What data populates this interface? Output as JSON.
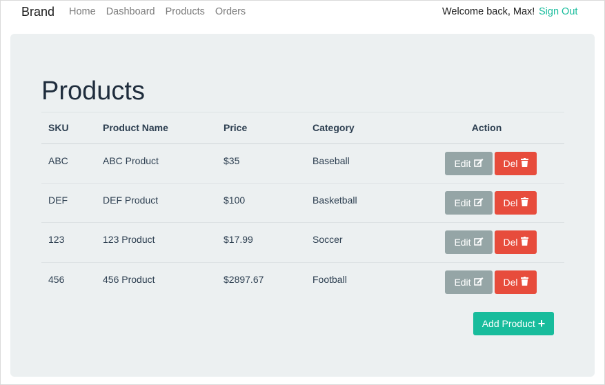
{
  "navbar": {
    "brand": "Brand",
    "links": [
      "Home",
      "Dashboard",
      "Products",
      "Orders"
    ],
    "welcome": "Welcome back, Max!",
    "signout": "Sign Out"
  },
  "page": {
    "title": "Products",
    "add_button": "Add Product"
  },
  "table": {
    "headers": [
      "SKU",
      "Product Name",
      "Price",
      "Category",
      "Action"
    ],
    "rows": [
      {
        "sku": "ABC",
        "name": "ABC Product",
        "price": "$35",
        "category": "Baseball"
      },
      {
        "sku": "DEF",
        "name": "DEF Product",
        "price": "$100",
        "category": "Basketball"
      },
      {
        "sku": "123",
        "name": "123 Product",
        "price": "$17.99",
        "category": "Soccer"
      },
      {
        "sku": "456",
        "name": "456 Product",
        "price": "$2897.67",
        "category": "Football"
      }
    ],
    "edit_label": "Edit",
    "delete_label": "Del"
  },
  "colors": {
    "accent": "#18bc9c",
    "edit": "#95a5a6",
    "delete": "#e74c3c",
    "panel": "#ecf0f1"
  },
  "icons": {
    "edit": "pencil-square-icon",
    "delete": "trash-icon",
    "add": "plus-icon"
  }
}
